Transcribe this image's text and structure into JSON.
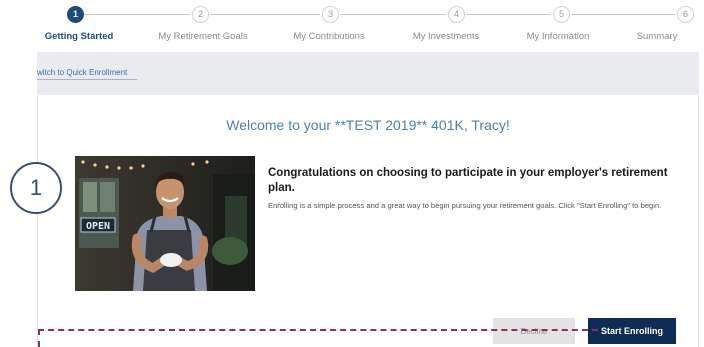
{
  "stepper": {
    "steps": [
      {
        "number": "1",
        "label": "Getting Started",
        "active": true
      },
      {
        "number": "2",
        "label": "My Retirement Goals",
        "active": false
      },
      {
        "number": "3",
        "label": "My Contributions",
        "active": false
      },
      {
        "number": "4",
        "label": "My Investments",
        "active": false
      },
      {
        "number": "5",
        "label": "My Information",
        "active": false
      },
      {
        "number": "6",
        "label": "Summary",
        "active": false
      }
    ],
    "active_color": "#1f4a80"
  },
  "quick_enrollment_link": "witch to Quick Enrollment",
  "welcome_text": "Welcome to your **TEST 2019** 401K, Tracy!",
  "photo": {
    "sign_text": "OPEN"
  },
  "congrats_heading": "Congratulations on choosing to participate in your employer's retirement plan.",
  "description": "Enrolling is a simple process and a great way to begin pursuing your retirement goals. Click \"Start Enrolling\" to begin.",
  "buttons": {
    "decline_label": "Decline",
    "start_label": "Start Enrolling",
    "start_color": "#0f2c54"
  },
  "callout": {
    "number": "1",
    "color": "#3b4f75"
  },
  "annotation_color": "#8a2e63"
}
